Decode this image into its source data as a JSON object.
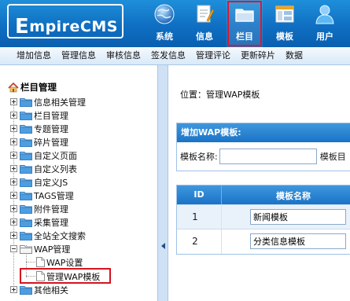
{
  "header": {
    "logo_initial": "E",
    "logo_rest": "mpireCMS",
    "nav": [
      {
        "label": "系统",
        "icon": "globe-icon",
        "active": false
      },
      {
        "label": "信息",
        "icon": "document-pencil-icon",
        "active": false
      },
      {
        "label": "栏目",
        "icon": "folder-icon",
        "active": true
      },
      {
        "label": "模板",
        "icon": "template-window-icon",
        "active": false
      },
      {
        "label": "用户",
        "icon": "user-icon",
        "active": false
      }
    ]
  },
  "submenu": [
    "增加信息",
    "管理信息",
    "审核信息",
    "签发信息",
    "管理评论",
    "更新碎片",
    "数据"
  ],
  "tree": {
    "title": "栏目管理",
    "items": [
      {
        "label": "信息相关管理",
        "type": "folder"
      },
      {
        "label": "栏目管理",
        "type": "folder"
      },
      {
        "label": "专题管理",
        "type": "folder"
      },
      {
        "label": "碎片管理",
        "type": "folder"
      },
      {
        "label": "自定义页面",
        "type": "folder"
      },
      {
        "label": "自定义列表",
        "type": "folder"
      },
      {
        "label": "自定义JS",
        "type": "folder"
      },
      {
        "label": "TAGS管理",
        "type": "folder"
      },
      {
        "label": "附件管理",
        "type": "folder"
      },
      {
        "label": "采集管理",
        "type": "folder"
      },
      {
        "label": "全站全文搜索",
        "type": "folder"
      },
      {
        "label": "WAP管理",
        "type": "folder-open"
      },
      {
        "label": "WAP设置",
        "type": "doc"
      },
      {
        "label": "管理WAP模板",
        "type": "doc",
        "selected": true
      },
      {
        "label": "其他相关",
        "type": "folder"
      }
    ]
  },
  "main": {
    "breadcrumb_prefix": "位置：",
    "breadcrumb_link": "管理WAP模板",
    "add_panel_title": "增加WAP模板:",
    "template_name_label": "模板名称:",
    "template_name_value": "",
    "template_dir_label": "模板目",
    "table_headers": [
      "ID",
      "模板名称"
    ],
    "rows": [
      {
        "id": "1",
        "name": "新闻模板"
      },
      {
        "id": "2",
        "name": "分类信息模板"
      }
    ]
  },
  "colors": {
    "header_blue": "#0f6fc2",
    "panel_head_blue": "#1a73c7",
    "selection_red": "#d3141f"
  }
}
